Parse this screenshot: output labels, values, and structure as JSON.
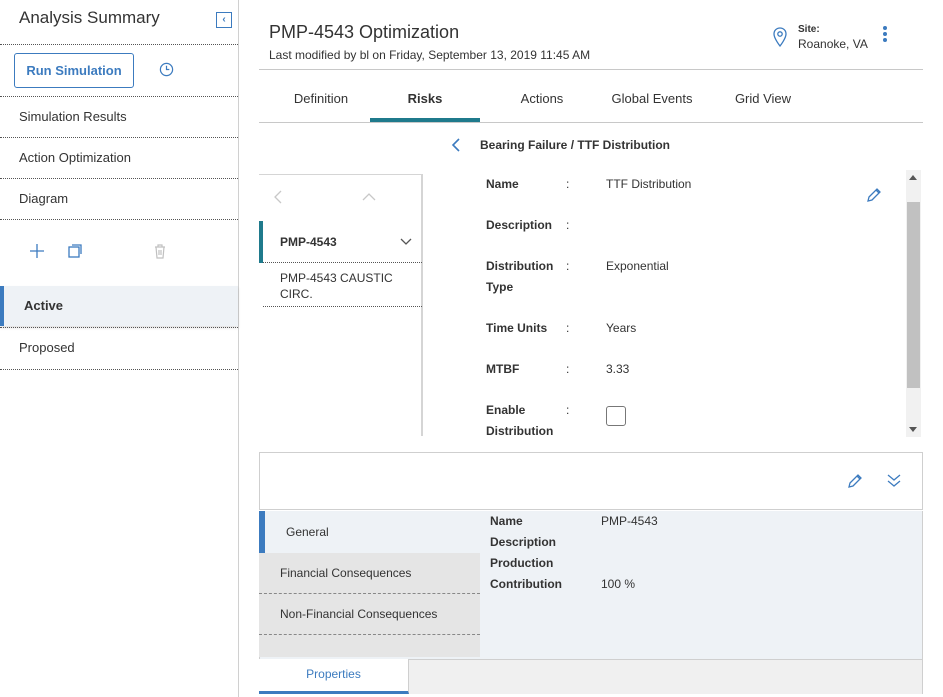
{
  "sidebar": {
    "title": "Analysis Summary",
    "run_simulation_label": "Run Simulation",
    "nav_items": [
      "Simulation Results",
      "Action Optimization",
      "Diagram"
    ],
    "scenarios": [
      {
        "label": "Active",
        "selected": true
      },
      {
        "label": "Proposed",
        "selected": false
      }
    ]
  },
  "header": {
    "title": "PMP-4543 Optimization",
    "subtitle": "Last modified by bl on Friday, September 13, 2019 11:45 AM",
    "site_label": "Site:",
    "site_value": "Roanoke, VA"
  },
  "tabs": [
    {
      "label": "Definition",
      "active": false
    },
    {
      "label": "Risks",
      "active": true
    },
    {
      "label": "Actions",
      "active": false
    },
    {
      "label": "Global Events",
      "active": false
    },
    {
      "label": "Grid View",
      "active": false
    }
  ],
  "risk": {
    "title": "Bearing Failure / TTF Distribution",
    "assets": [
      {
        "label": "PMP-4543",
        "selected": true
      },
      {
        "label": "PMP-4543 CAUSTIC CIRC.",
        "selected": false
      }
    ],
    "fields": [
      {
        "label": "Name",
        "value": "TTF Distribution"
      },
      {
        "label": "Description",
        "value": ""
      },
      {
        "label": "Distribution Type",
        "value": "Exponential"
      },
      {
        "label": "Time Units",
        "value": "Years"
      },
      {
        "label": "MTBF",
        "value": "3.33"
      },
      {
        "label": "Enable Distribution",
        "value": "",
        "checked": false
      }
    ],
    "colon": ":"
  },
  "properties": {
    "nav": [
      {
        "label": "General",
        "selected": true
      },
      {
        "label": "Financial Consequences",
        "selected": false
      },
      {
        "label": "Non-Financial Consequences",
        "selected": false
      }
    ],
    "fields": [
      {
        "label": "Name",
        "value": "PMP-4543"
      },
      {
        "label": "Description",
        "value": ""
      },
      {
        "label": "Production",
        "value": ""
      },
      {
        "label": "Contribution",
        "value": "100 %"
      }
    ],
    "bottom_tab": "Properties"
  },
  "colors": {
    "accent_blue": "#3c7bbf",
    "accent_teal": "#1f7a8c"
  },
  "icons": [
    "collapse-sidebar-icon",
    "history-icon",
    "add-icon",
    "copy-icon",
    "delete-icon",
    "location-pin-icon",
    "more-vert-icon",
    "back-chevron-icon",
    "chevron-left-icon",
    "chevron-up-icon",
    "chevron-down-icon",
    "pencil-icon",
    "double-chevron-down-icon"
  ]
}
